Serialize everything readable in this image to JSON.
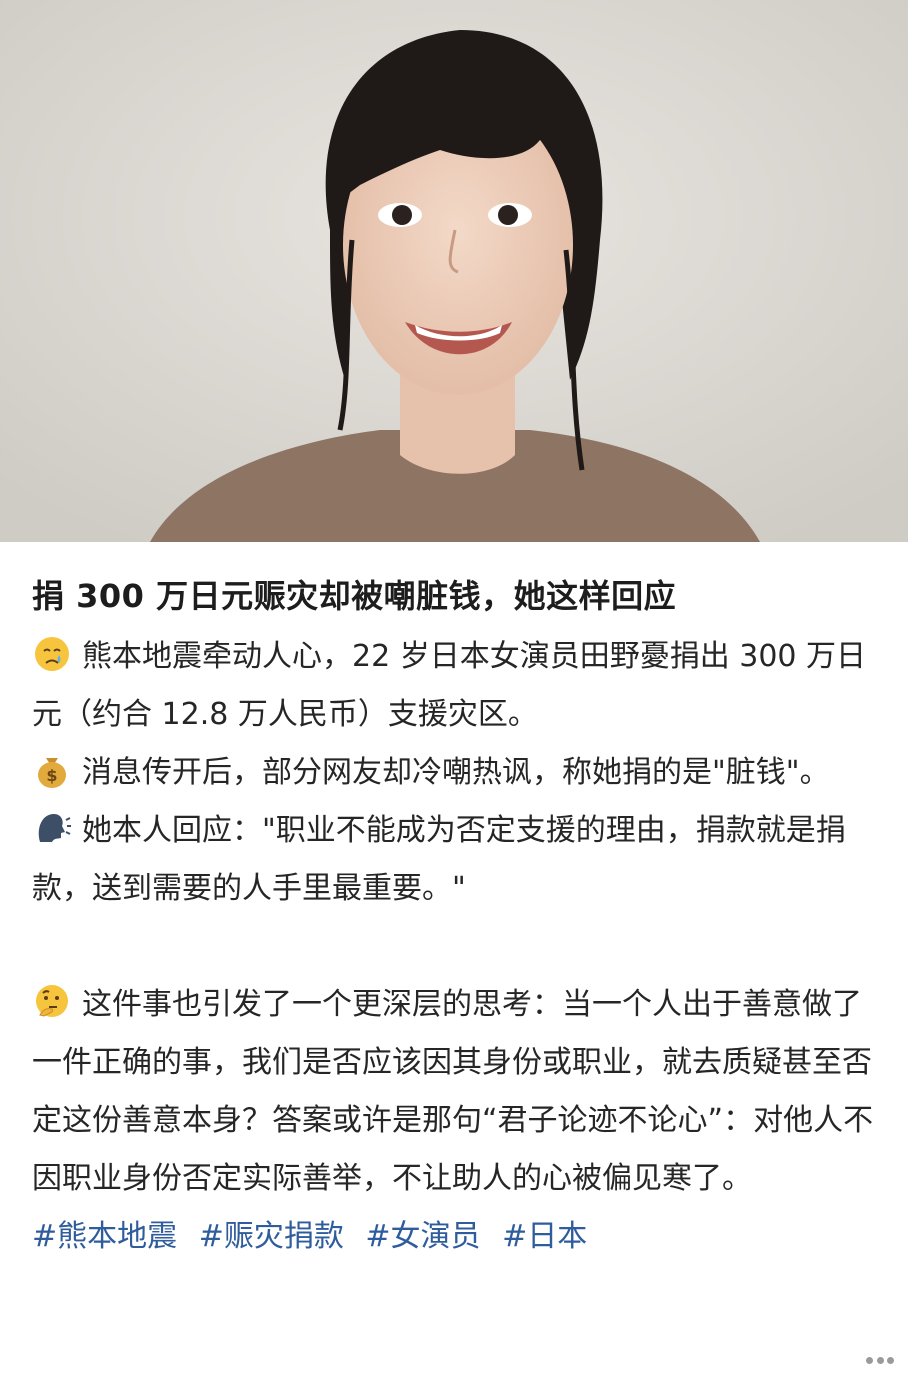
{
  "post": {
    "title": "捐 300 万日元赈灾却被嘲脏钱，她这样回应",
    "paragraphs": [
      {
        "icon": "crying-face-icon",
        "text": "熊本地震牵动人心，22 岁日本女演员田野憂捐出 300 万日元（约合 12.8 万人民币）支援灾区。"
      },
      {
        "icon": "money-bag-icon",
        "text": "消息传开后，部分网友却冷嘲热讽，称她捐的是\"脏钱\"。"
      },
      {
        "icon": "speaking-head-icon",
        "text": "她本人回应：\"职业不能成为否定支援的理由，捐款就是捐款，送到需要的人手里最重要。\""
      },
      {
        "icon": "thinking-face-icon",
        "text": "这件事也引发了一个更深层的思考：当一个人出于善意做了一件正确的事，我们是否应该因其身份或职业，就去质疑甚至否定这份善意本身？答案或许是那句“君子论迹不论心”：对他人不因职业身份否定实际善举，不让助人的心被偏见寒了。"
      }
    ],
    "tags": [
      "#熊本地震",
      "#赈灾捐款",
      "#女演员",
      "#日本"
    ]
  },
  "colors": {
    "tag": "#2f5d9c",
    "text": "#262626",
    "title": "#1d1d1d"
  }
}
